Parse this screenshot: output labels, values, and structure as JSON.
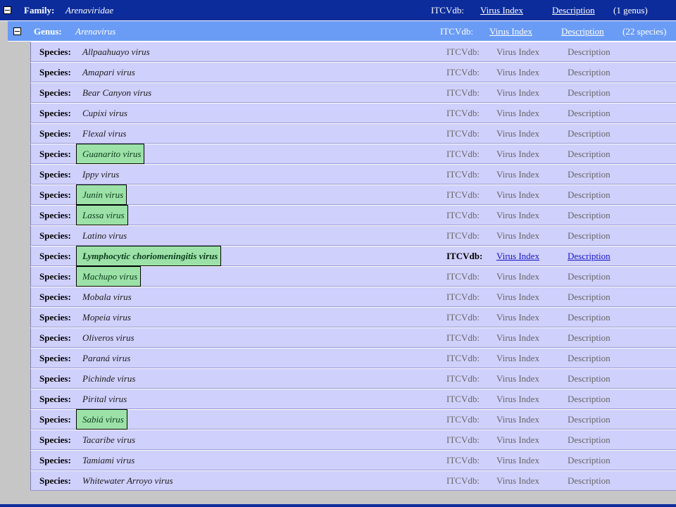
{
  "family": {
    "label": "Family:",
    "name": "Arenaviridae",
    "db_label": "ITCVdb:",
    "virus_index": "Virus Index",
    "description": "Description",
    "count": "(1 genus)"
  },
  "genus": {
    "label": "Genus:",
    "name": "Arenavirus",
    "db_label": "ITCVdb:",
    "virus_index": "Virus Index",
    "description": "Description",
    "count": "(22 species)"
  },
  "species_label": "Species:",
  "db_label": "ITCVdb:",
  "virus_index": "Virus Index",
  "description": "Description",
  "colors": {
    "family_bg": "#0c2c9c",
    "genus_bg": "#6a9cf6",
    "species_bg": "#d0d0fc",
    "highlight": "#9ce2a8",
    "link_active": "#1414c8"
  },
  "species": [
    {
      "name": "Allpaahuayo virus",
      "highlight": false,
      "active": false
    },
    {
      "name": "Amapari virus",
      "highlight": false,
      "active": false
    },
    {
      "name": "Bear Canyon virus",
      "highlight": false,
      "active": false
    },
    {
      "name": "Cupixi virus",
      "highlight": false,
      "active": false
    },
    {
      "name": "Flexal virus",
      "highlight": false,
      "active": false
    },
    {
      "name": "Guanarito virus",
      "highlight": true,
      "active": false
    },
    {
      "name": "Ippy virus",
      "highlight": false,
      "active": false
    },
    {
      "name": "Junin virus",
      "highlight": true,
      "active": false
    },
    {
      "name": "Lassa virus",
      "highlight": true,
      "active": false
    },
    {
      "name": "Latino virus",
      "highlight": false,
      "active": false
    },
    {
      "name": "Lymphocytic choriomeningitis virus",
      "highlight": true,
      "active": true
    },
    {
      "name": "Machupo virus",
      "highlight": true,
      "active": false
    },
    {
      "name": "Mobala virus",
      "highlight": false,
      "active": false
    },
    {
      "name": "Mopeia virus",
      "highlight": false,
      "active": false
    },
    {
      "name": "Oliveros virus",
      "highlight": false,
      "active": false
    },
    {
      "name": "Paraná virus",
      "highlight": false,
      "active": false
    },
    {
      "name": "Pichinde virus",
      "highlight": false,
      "active": false
    },
    {
      "name": "Pirital virus",
      "highlight": false,
      "active": false
    },
    {
      "name": "Sabiá virus",
      "highlight": true,
      "active": false
    },
    {
      "name": "Tacaribe virus",
      "highlight": false,
      "active": false
    },
    {
      "name": "Tamiami virus",
      "highlight": false,
      "active": false
    },
    {
      "name": "Whitewater Arroyo virus",
      "highlight": false,
      "active": false
    }
  ]
}
